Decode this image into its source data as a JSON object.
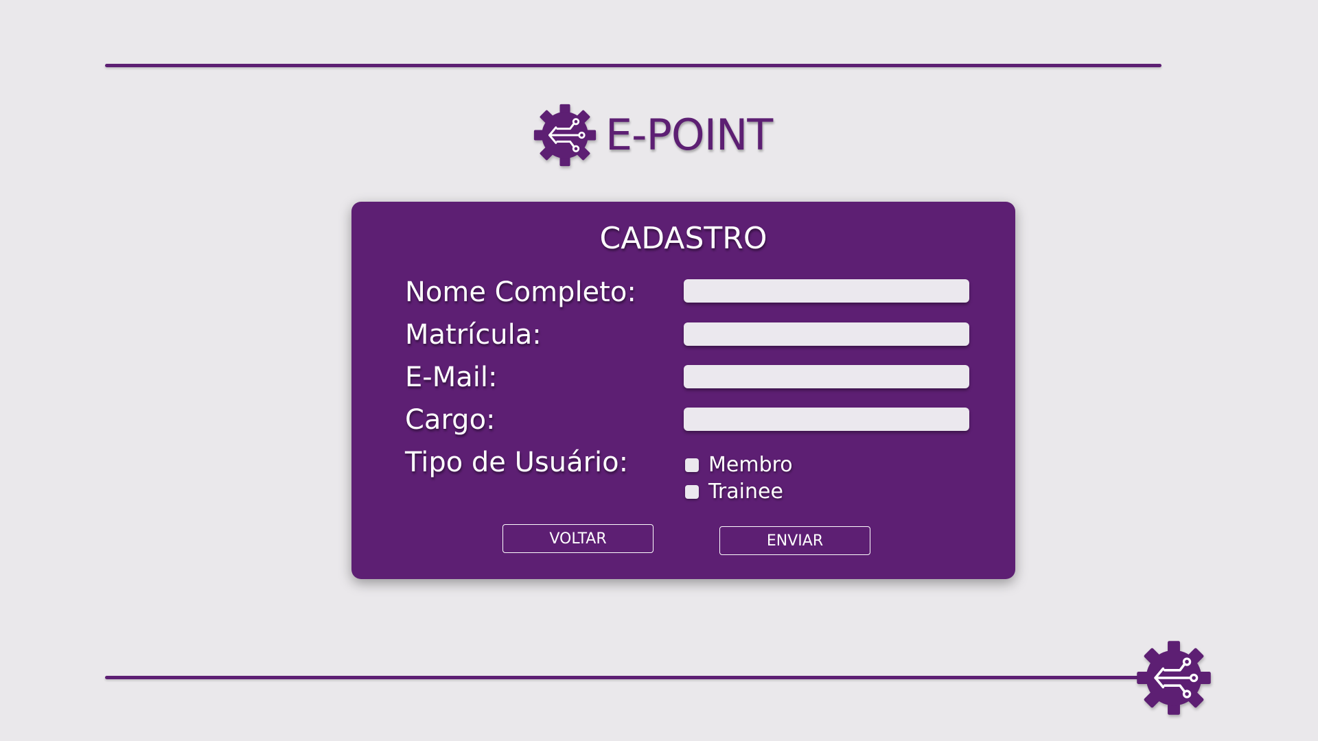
{
  "brand": {
    "name": "E-POINT",
    "logo_icon": "gear-circuit-icon",
    "color": "#5d1f73"
  },
  "form": {
    "title": "CADASTRO",
    "fields": [
      {
        "label": "Nome Completo:",
        "value": "",
        "placeholder": ""
      },
      {
        "label": "Matrícula:",
        "value": "",
        "placeholder": ""
      },
      {
        "label": "E-Mail:",
        "value": "",
        "placeholder": ""
      },
      {
        "label": "Cargo:",
        "value": "",
        "placeholder": ""
      }
    ],
    "user_type": {
      "label": "Tipo de Usuário:",
      "options": [
        {
          "label": "Membro",
          "checked": false
        },
        {
          "label": "Trainee",
          "checked": false
        }
      ]
    },
    "buttons": {
      "back": "VOLTAR",
      "submit": "ENVIAR"
    }
  },
  "colors": {
    "background": "#eae8eb",
    "primary": "#5d1f73",
    "field": "#ebe8ee",
    "text_on_primary": "#ffffff"
  }
}
